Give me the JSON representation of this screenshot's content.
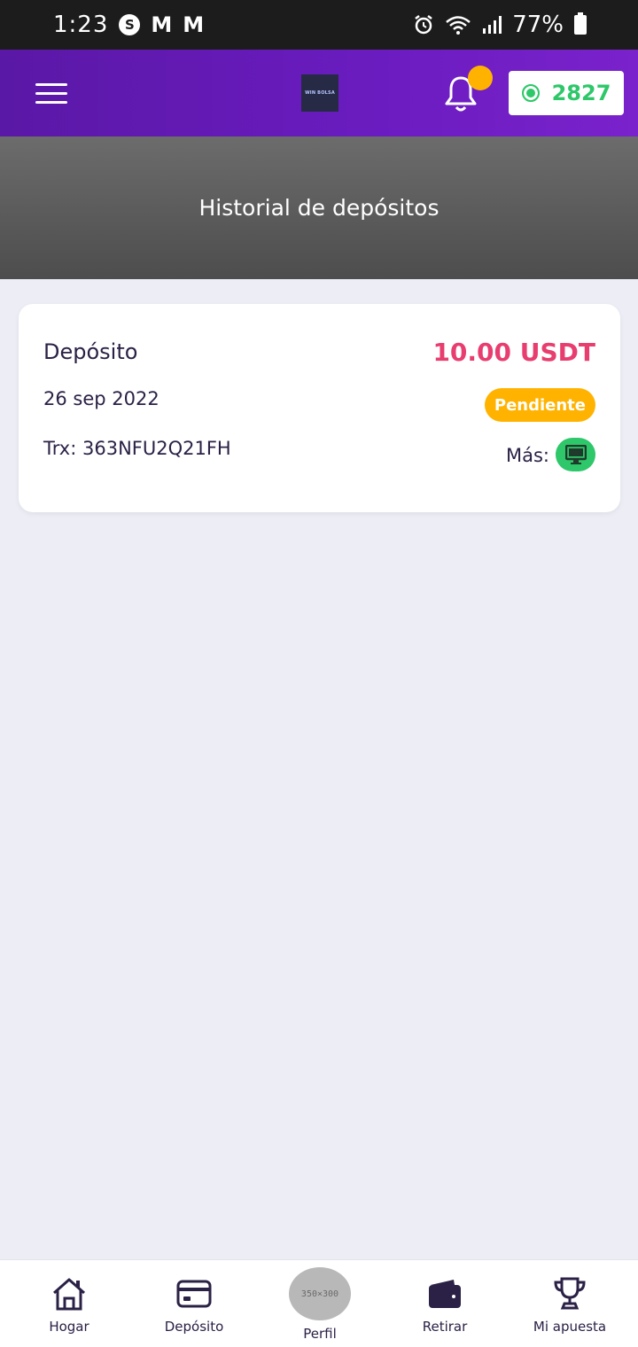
{
  "status_bar": {
    "time": "1:23",
    "battery": "77%",
    "notification_icons": [
      "s-icon",
      "gmail-icon",
      "gmail-icon"
    ],
    "system_icons": [
      "alarm-icon",
      "wifi-icon",
      "signal-icon",
      "battery-icon"
    ]
  },
  "header": {
    "logo_text": "WIN BOLSA",
    "balance": "2827",
    "has_notification": true,
    "colors": {
      "gradient_start": "#5a18a6",
      "gradient_end": "#7a22cc",
      "notification_dot": "#ffb300",
      "balance": "#2ec76a"
    }
  },
  "banner": {
    "title": "Historial de depósitos"
  },
  "deposits": [
    {
      "label": "Depósito",
      "date": "26 sep 2022",
      "trx": "Trx: 363NFU2Q21FH",
      "amount": "10.00 USDT",
      "status": "Pendiente",
      "more_label": "Más:",
      "colors": {
        "amount": "#e83d6f",
        "status": "#ffb300",
        "more_button": "#2ec76a"
      }
    }
  ],
  "bottom_nav": {
    "items": [
      {
        "label": "Hogar",
        "icon": "home-icon"
      },
      {
        "label": "Depósito",
        "icon": "card-icon"
      },
      {
        "label": "Perfil",
        "icon": "avatar-placeholder",
        "avatar_text": "350×300"
      },
      {
        "label": "Retirar",
        "icon": "wallet-icon"
      },
      {
        "label": "Mi apuesta",
        "icon": "trophy-icon"
      }
    ]
  }
}
